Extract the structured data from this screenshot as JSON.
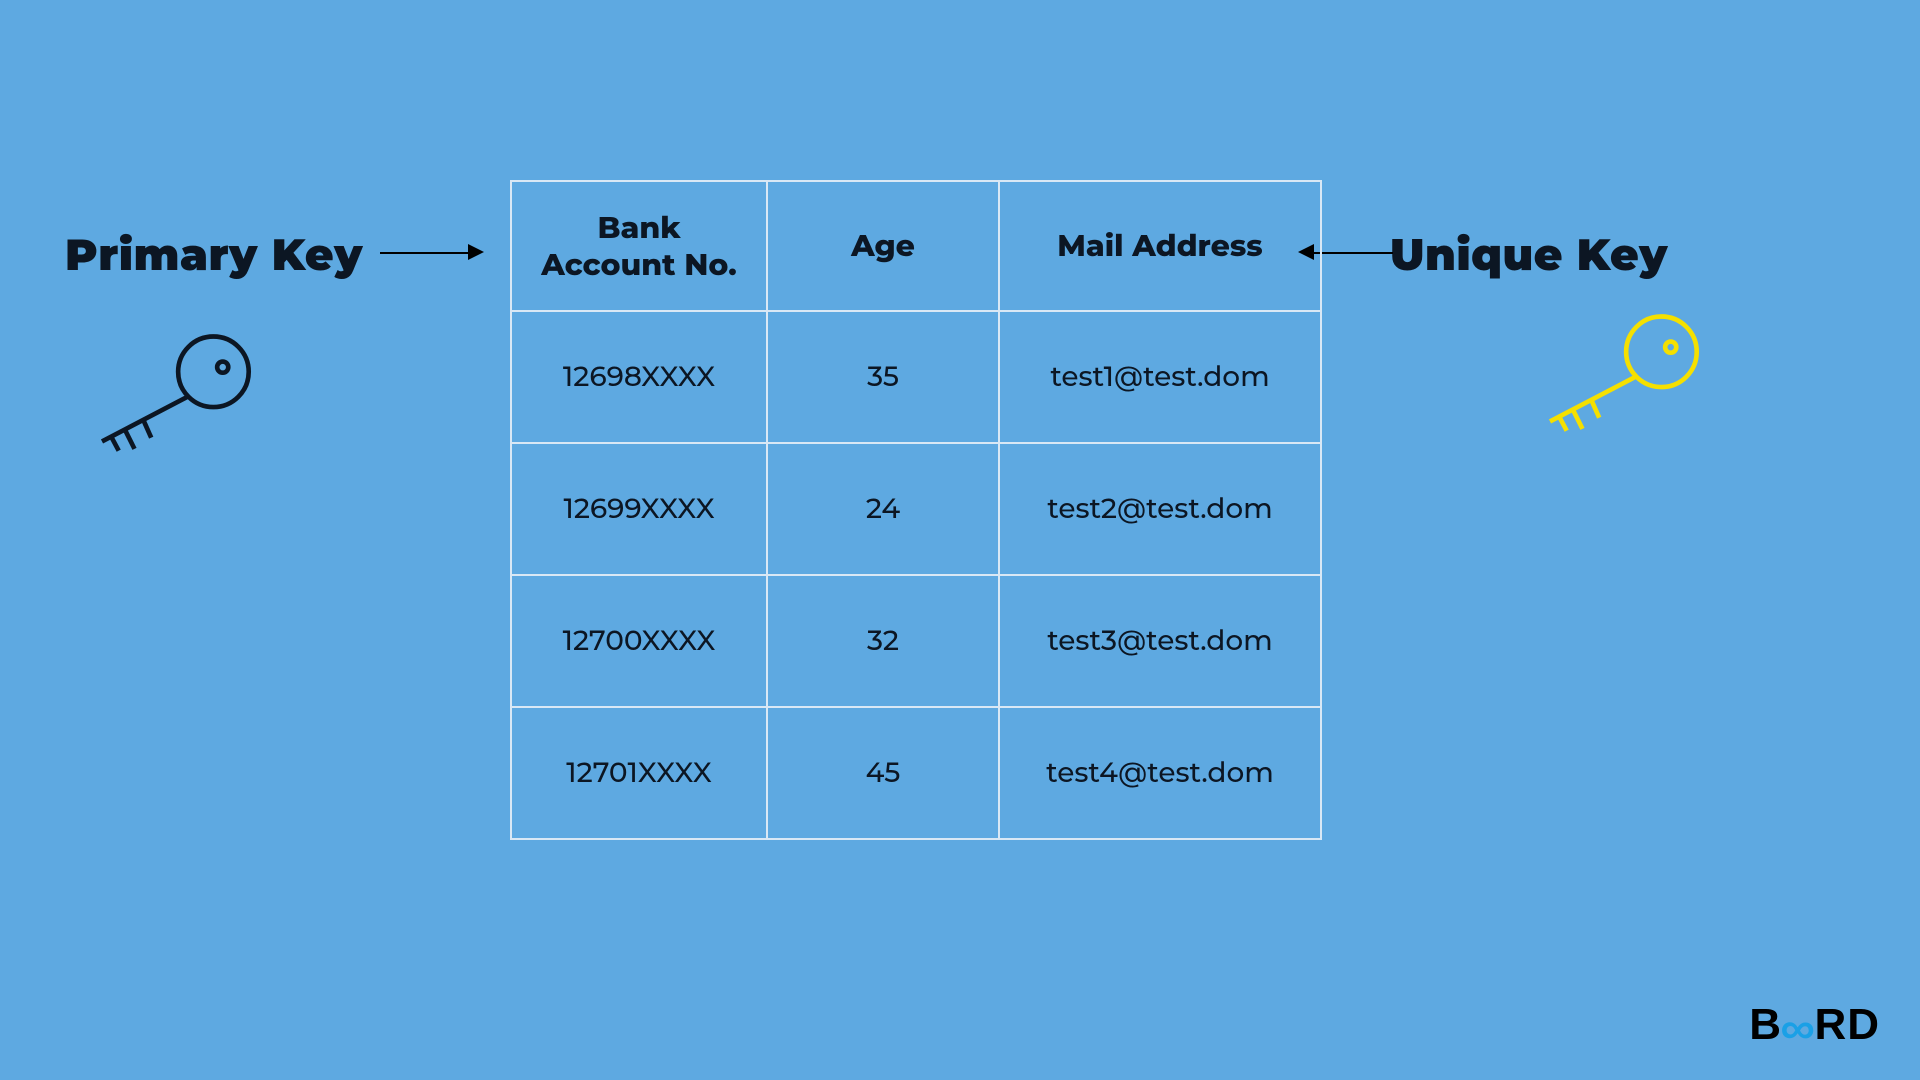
{
  "labels": {
    "primary": "Primary Key",
    "unique": "Unique Key"
  },
  "table": {
    "headers": {
      "bank": "Bank\nAccount No.",
      "age": "Age",
      "mail": "Mail Address"
    },
    "rows": [
      {
        "bank": "12698XXXX",
        "age": "35",
        "mail": "test1@test.dom"
      },
      {
        "bank": "12699XXXX",
        "age": "24",
        "mail": "test2@test.dom"
      },
      {
        "bank": "12700XXXX",
        "age": "32",
        "mail": "test3@test.dom"
      },
      {
        "bank": "12701XXXX",
        "age": "45",
        "mail": "test4@test.dom"
      }
    ]
  },
  "logo": {
    "b": "B",
    "rd": "RD"
  }
}
